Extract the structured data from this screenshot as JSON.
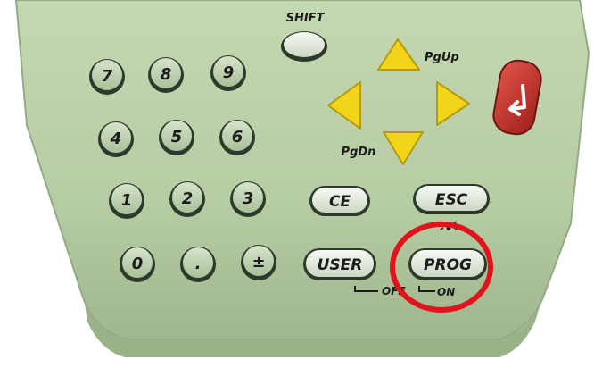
{
  "device": {
    "body_color": "#b8cfa6",
    "body_edge_color": "#8ea882",
    "key_color": "#e9efe3",
    "key_outline_color": "#2d3a2b",
    "arrow_color": "#f2d41a",
    "enter_color": "#c23028",
    "highlight_color": "#e0141c"
  },
  "labels": {
    "shift": "SHIFT",
    "pgup": "PgUp",
    "pgdn": "PgDn",
    "off": "OFF",
    "on": "ON"
  },
  "keys": {
    "k7": "7",
    "k8": "8",
    "k9": "9",
    "k4": "4",
    "k5": "5",
    "k6": "6",
    "k1": "1",
    "k2": "2",
    "k3": "3",
    "k0": "0",
    "dot": ".",
    "plusminus": "±",
    "ce": "CE",
    "esc": "ESC",
    "user": "USER",
    "prog": "PROG"
  },
  "icons": {
    "enter": "enter-return-icon",
    "arrow_up": "arrow-up-icon",
    "arrow_down": "arrow-down-icon",
    "arrow_left": "arrow-left-icon",
    "arrow_right": "arrow-right-icon",
    "light": "light-bulb-icon"
  }
}
